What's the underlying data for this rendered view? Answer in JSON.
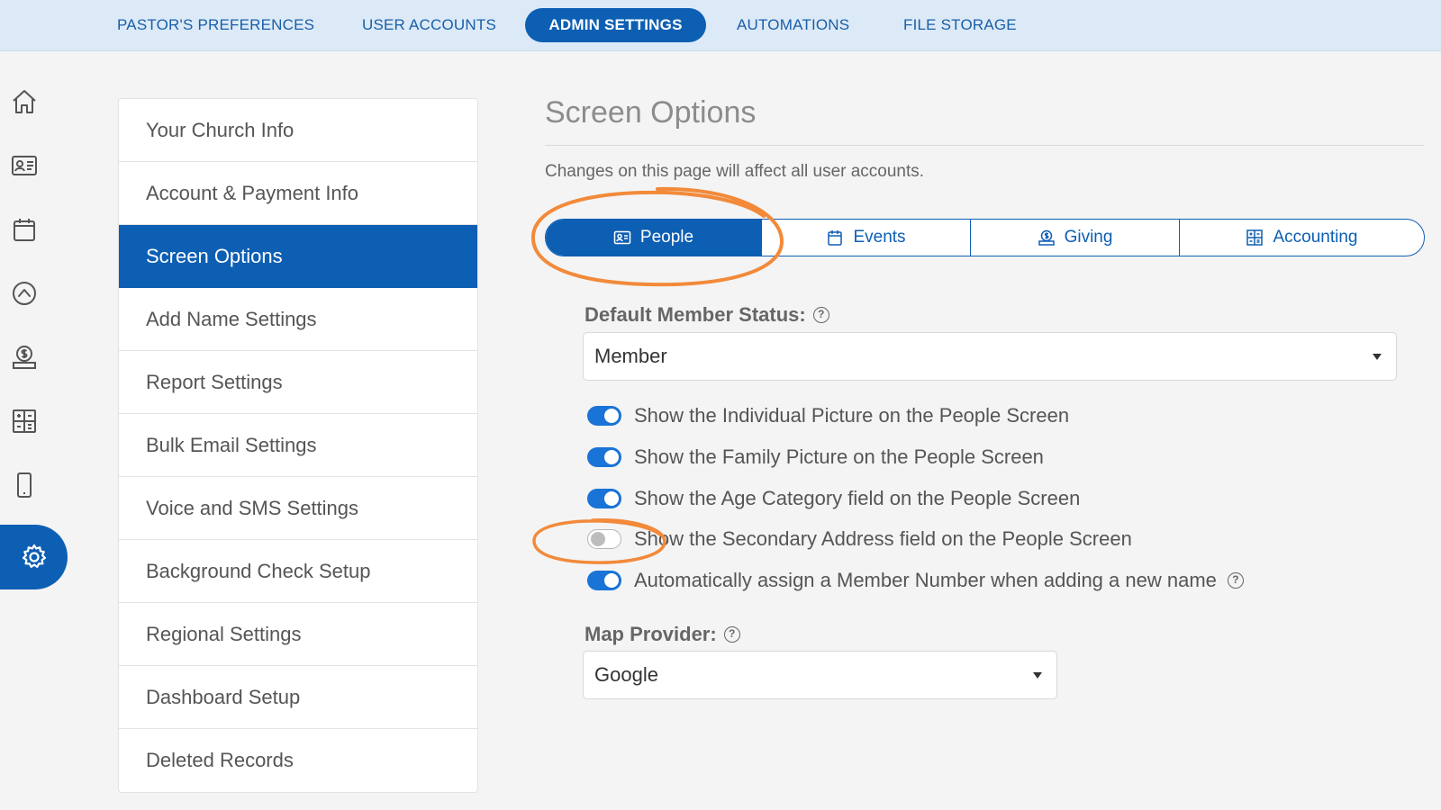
{
  "top_nav": {
    "tabs": [
      {
        "label": "PASTOR'S PREFERENCES",
        "active": false
      },
      {
        "label": "USER ACCOUNTS",
        "active": false
      },
      {
        "label": "ADMIN SETTINGS",
        "active": true
      },
      {
        "label": "AUTOMATIONS",
        "active": false
      },
      {
        "label": "FILE STORAGE",
        "active": false
      }
    ]
  },
  "left_rail": {
    "icons": [
      "home-icon",
      "id-card-icon",
      "calendar-icon",
      "chevron-up-circle-icon",
      "giving-icon",
      "accounting-grid-icon",
      "mobile-icon",
      "gear-icon"
    ],
    "active": "gear-icon"
  },
  "settings_menu": {
    "items": [
      {
        "label": "Your Church Info"
      },
      {
        "label": "Account & Payment Info"
      },
      {
        "label": "Screen Options"
      },
      {
        "label": "Add Name Settings"
      },
      {
        "label": "Report Settings"
      },
      {
        "label": "Bulk Email Settings"
      },
      {
        "label": "Voice and SMS Settings"
      },
      {
        "label": "Background Check Setup"
      },
      {
        "label": "Regional Settings"
      },
      {
        "label": "Dashboard Setup"
      },
      {
        "label": "Deleted Records"
      }
    ],
    "active": "Screen Options"
  },
  "main": {
    "title": "Screen Options",
    "description": "Changes on this page will affect all user accounts.",
    "tabs": [
      {
        "label": "People",
        "icon": "id-card-icon",
        "active": true
      },
      {
        "label": "Events",
        "icon": "calendar-icon",
        "active": false
      },
      {
        "label": "Giving",
        "icon": "giving-icon",
        "active": false
      },
      {
        "label": "Accounting",
        "icon": "accounting-grid-icon",
        "active": false
      }
    ],
    "default_member_status": {
      "label": "Default Member Status:",
      "value": "Member"
    },
    "options": [
      {
        "label": "Show the Individual Picture on the People Screen",
        "enabled": true
      },
      {
        "label": "Show the Family Picture on the People Screen",
        "enabled": true
      },
      {
        "label": "Show the Age Category field on the People Screen",
        "enabled": true
      },
      {
        "label": "Show the Secondary Address field on the People Screen",
        "enabled": false
      },
      {
        "label": "Automatically assign a Member Number when adding a new name",
        "enabled": true
      }
    ],
    "map_provider": {
      "label": "Map Provider:",
      "value": "Google"
    }
  },
  "colors": {
    "primary": "#0d5fb3",
    "toggle_on": "#1a73d6",
    "topnav_bg": "#dceaf7",
    "annotation": "#f28a3a"
  }
}
